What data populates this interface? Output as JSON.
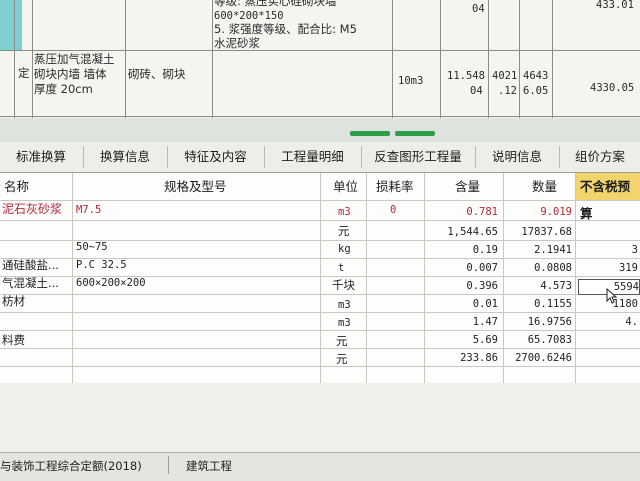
{
  "upper_table": {
    "row1": {
      "code_tail": "...",
      "spec_line1": "等级: 蒸压实心硅砌块墙",
      "spec_line2": "600*200*150",
      "spec_line3": "5. 浆强度等级、配合比: M5",
      "spec_line4": "水泥砂浆",
      "qty": "04",
      "amount": "433.01"
    },
    "row2": {
      "type": "定",
      "name_line1": "蒸压加气混凝土",
      "name_line2": "砌块内墙 墙体",
      "name_line3": "厚度 20cm",
      "category": "砌砖、砌块",
      "unit": "10m3",
      "v1_line1": "11.548",
      "v1_line2": "04",
      "v2_line1": "4021",
      "v2_line2": ".12",
      "v3_line1": "4643",
      "v3_line2": "6.05",
      "total": "4330.05"
    }
  },
  "tabs": [
    "标准换算",
    "换算信息",
    "特征及内容",
    "工程量明细",
    "反查图形工程量",
    "说明信息",
    "组价方案"
  ],
  "grid": {
    "headers": {
      "name": "名称",
      "spec": "规格及型号",
      "unit": "单位",
      "loss": "损耗率",
      "content": "含量",
      "qty": "数量",
      "price": "不含税预算"
    },
    "rows": [
      {
        "name": "泥石灰砂浆",
        "spec": "M7.5",
        "unit": "m3",
        "loss": "0",
        "content": "0.781",
        "qty": "9.019",
        "price": ""
      },
      {
        "name": "",
        "spec": "",
        "unit": "元",
        "loss": "",
        "content": "1,544.65",
        "qty": "17837.68",
        "price": ""
      },
      {
        "name": "",
        "spec": "50~75",
        "unit": "kg",
        "loss": "",
        "content": "0.19",
        "qty": "2.1941",
        "price": "3"
      },
      {
        "name": "通硅酸盐...",
        "spec": "P.C 32.5",
        "unit": "t",
        "loss": "",
        "content": "0.007",
        "qty": "0.0808",
        "price": "319"
      },
      {
        "name": "气混凝土...",
        "spec": "600×200×200",
        "unit": "千块",
        "loss": "",
        "content": "0.396",
        "qty": "4.573",
        "price": "5594"
      },
      {
        "name": "枋材",
        "spec": "",
        "unit": "m3",
        "loss": "",
        "content": "0.01",
        "qty": "0.1155",
        "price": "1180"
      },
      {
        "name": "",
        "spec": "",
        "unit": "m3",
        "loss": "",
        "content": "1.47",
        "qty": "16.9756",
        "price": "4."
      },
      {
        "name": "料费",
        "spec": "",
        "unit": "元",
        "loss": "",
        "content": "5.69",
        "qty": "65.7083",
        "price": ""
      },
      {
        "name": "",
        "spec": "",
        "unit": "元",
        "loss": "",
        "content": "233.86",
        "qty": "2700.6246",
        "price": ""
      }
    ]
  },
  "status_bar": {
    "left": "与装饰工程综合定额(2018)",
    "right": "建筑工程"
  },
  "colors": {
    "teal": "#7ed0cf",
    "accent_green": "#2e9e4c",
    "highlight": "#f3d36b",
    "red_text": "#b0283a"
  }
}
